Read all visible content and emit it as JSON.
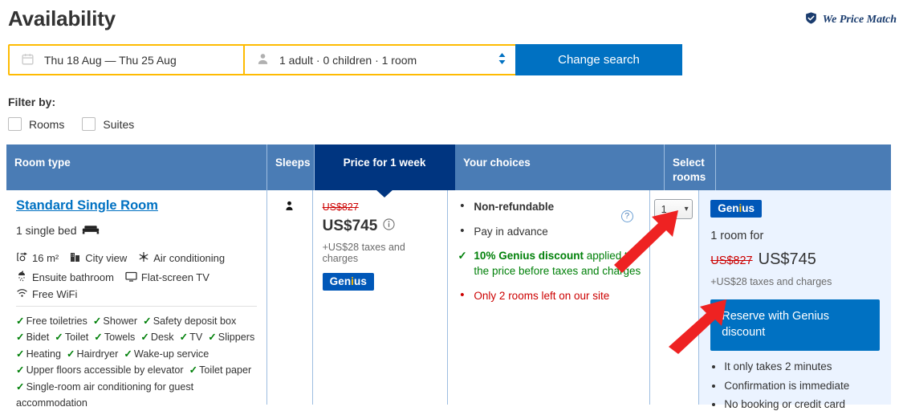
{
  "header": {
    "title": "Availability",
    "price_match": "We Price Match",
    "price_match_icon": "shield-check-icon"
  },
  "search": {
    "dates": "Thu 18 Aug — Thu 25 Aug",
    "occupancy": "1 adult  ·  0 children  ·  1 room",
    "change_button": "Change search",
    "calendar_icon": "calendar-icon",
    "person_icon": "person-icon",
    "stepper_icon": "up-down-chevron-icon"
  },
  "filter": {
    "label": "Filter by:",
    "options": [
      {
        "label": "Rooms",
        "checked": false
      },
      {
        "label": "Suites",
        "checked": false
      }
    ]
  },
  "table": {
    "headers": {
      "room_type": "Room type",
      "sleeps": "Sleeps",
      "price": "Price for 1 week",
      "choices": "Your choices",
      "select_rooms": "Select\nrooms",
      "select_rooms_line1": "Select",
      "select_rooms_line2": "rooms"
    },
    "row": {
      "room_title": "Standard Single Room",
      "bed": "1 single bed",
      "bed_icon": "bed-icon",
      "features_row1": [
        {
          "icon": "size-icon",
          "label": "16 m²"
        },
        {
          "icon": "city-view-icon",
          "label": "City view"
        },
        {
          "icon": "air-conditioning-icon",
          "label": "Air conditioning"
        }
      ],
      "features_row2": [
        {
          "icon": "shower-icon",
          "label": "Ensuite bathroom"
        },
        {
          "icon": "tv-icon",
          "label": "Flat-screen TV"
        },
        {
          "icon": "wifi-icon",
          "label": "Free WiFi"
        }
      ],
      "amenities": [
        [
          "Free toiletries",
          "Shower",
          "Safety deposit box"
        ],
        [
          "Bidet",
          "Toilet",
          "Towels",
          "Desk",
          "TV",
          "Slippers"
        ],
        [
          "Heating",
          "Hairdryer",
          "Wake-up service"
        ],
        [
          "Upper floors accessible by elevator",
          "Toilet paper"
        ],
        [
          "Single-room air conditioning for guest accommodation"
        ]
      ],
      "sleeps_icon": "person-icon",
      "price": {
        "original": "US$827",
        "current": "US$745",
        "info_icon": "info-icon",
        "taxes": "+US$28 taxes and charges",
        "genius_badge_pre": "Gen",
        "genius_badge_dot": "i",
        "genius_badge_post": "us"
      },
      "choices": [
        {
          "marker": "bullet",
          "style": "bold",
          "text": "Non-refundable"
        },
        {
          "marker": "bullet",
          "style": "normal",
          "text": "Pay in advance"
        },
        {
          "marker": "check",
          "style": "green",
          "strong": "10% Genius discount",
          "text": " applied to the price before taxes and charges"
        },
        {
          "marker": "bullet",
          "style": "red",
          "text": "Only 2 rooms left on our site"
        }
      ],
      "help_icon": "question-mark-icon",
      "select": {
        "value": "1",
        "chevron": "chevron-down-icon"
      }
    }
  },
  "genius_panel": {
    "badge_pre": "Gen",
    "badge_dot": "i",
    "badge_post": "us",
    "room_for": "1 room for",
    "original_price": "US$827",
    "current_price": "US$745",
    "taxes": "+US$28 taxes and charges",
    "reserve_button": "Reserve with Genius discount",
    "bullets": [
      "It only takes 2 minutes",
      "Confirmation is immediate",
      "No booking or credit card"
    ]
  },
  "annotations": {
    "arrow_color": "#ee2222",
    "arrow_1_target": "select-rooms-dropdown",
    "arrow_2_target": "reserve-button"
  },
  "colors": {
    "brand_blue": "#0071c2",
    "dark_blue": "#003580",
    "header_blue": "#4a7cb5",
    "yellow": "#febb02",
    "green": "#008009",
    "red": "#cc0000",
    "panel_bg": "#ebf3ff"
  }
}
